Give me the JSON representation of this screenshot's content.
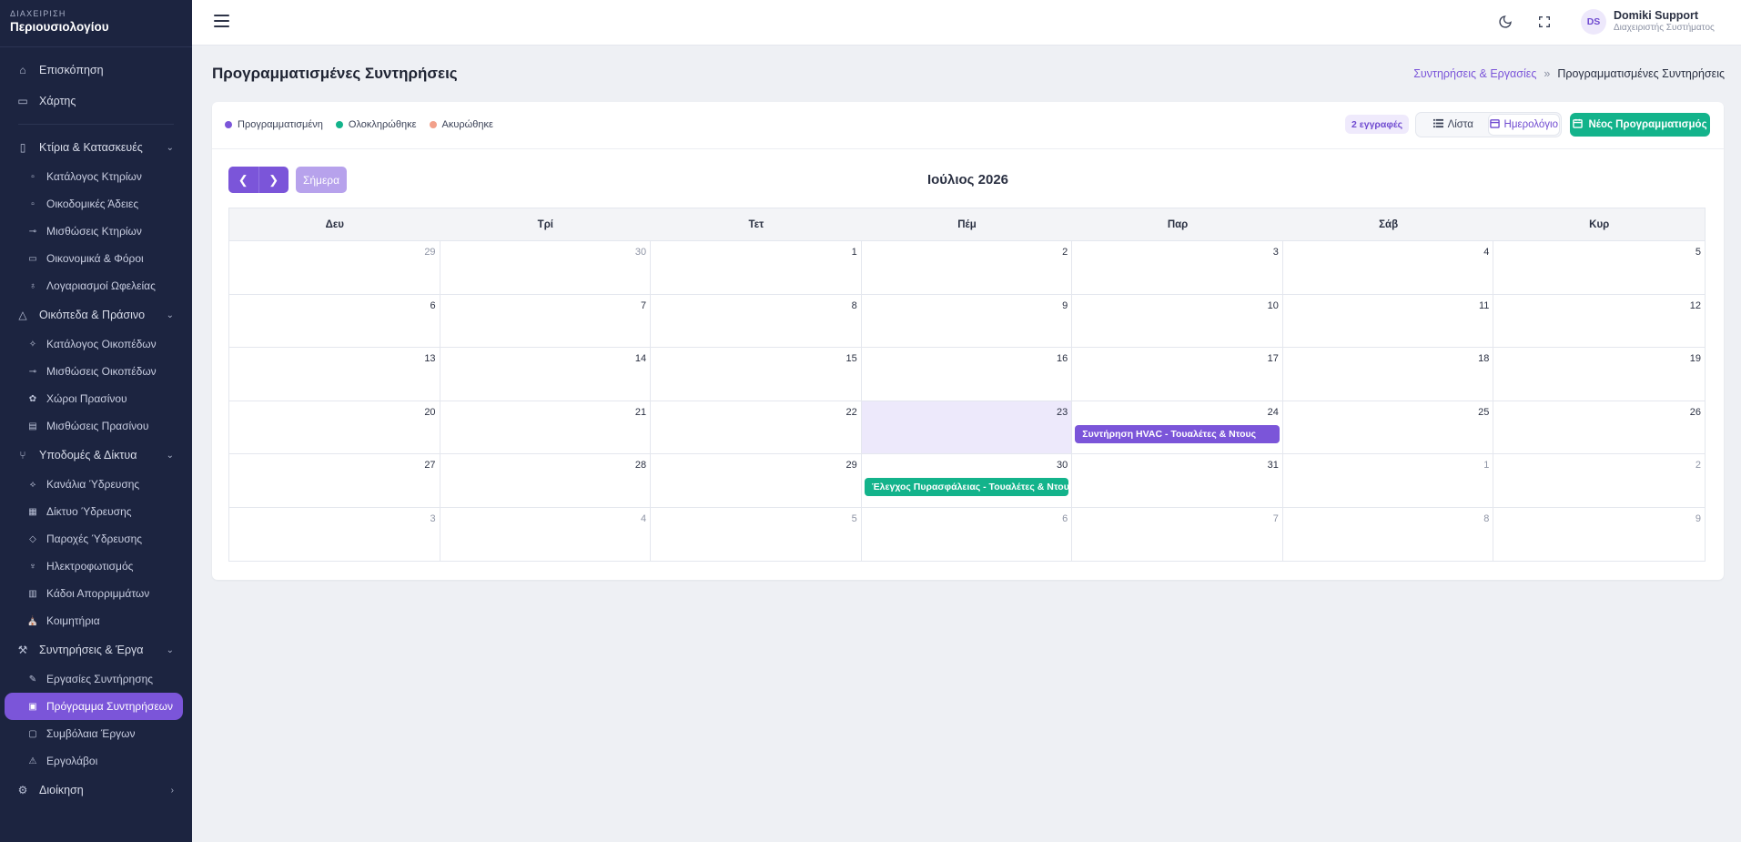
{
  "brand": {
    "small": "ΔΙΑΧΕΙΡΙΣΗ",
    "main": "Περιουσιολογίου"
  },
  "sidebar": {
    "items": [
      {
        "label": "Επισκόπηση",
        "icon": "home-icon"
      },
      {
        "label": "Χάρτης",
        "icon": "map-icon"
      }
    ],
    "groups": [
      {
        "label": "Κτίρια & Κατασκευές",
        "icon": "building-icon",
        "children": [
          "Κατάλογος Κτηρίων",
          "Οικοδομικές Άδειες",
          "Μισθώσεις Κτηρίων",
          "Οικονομικά & Φόροι",
          "Λογαριασμοί Ωφελείας"
        ]
      },
      {
        "label": "Οικόπεδα & Πράσινο",
        "icon": "land-icon",
        "children": [
          "Κατάλογος Οικοπέδων",
          "Μισθώσεις Οικοπέδων",
          "Χώροι Πρασίνου",
          "Μισθώσεις Πρασίνου"
        ]
      },
      {
        "label": "Υποδομές & Δίκτυα",
        "icon": "network-icon",
        "children": [
          "Κανάλια Ύδρευσης",
          "Δίκτυο Ύδρευσης",
          "Παροχές Ύδρευσης",
          "Ηλεκτροφωτισμός",
          "Κάδοι Απορριμμάτων",
          "Κοιμητήρια"
        ]
      },
      {
        "label": "Συντηρήσεις & Έργα",
        "icon": "wrench-icon",
        "children": [
          "Εργασίες Συντήρησης",
          "Πρόγραμμα Συντηρήσεων",
          "Συμβόλαια Έργων",
          "Εργολάβοι"
        ]
      }
    ],
    "admin": "Διοίκηση",
    "active": "Πρόγραμμα Συντηρήσεων"
  },
  "user": {
    "initials": "DS",
    "name": "Domiki Support",
    "role": "Διαχειριστής Συστήματος"
  },
  "page": {
    "title": "Προγραμματισμένες Συντηρήσεις"
  },
  "breadcrumb": {
    "parent": "Συντηρήσεις & Εργασίες",
    "sep": "»",
    "current": "Προγραμματισμένες Συντηρήσεις"
  },
  "legend": [
    {
      "label": "Προγραμματισμένη",
      "color": "#7b55d9"
    },
    {
      "label": "Ολοκληρώθηκε",
      "color": "#13b38b"
    },
    {
      "label": "Ακυρώθηκε",
      "color": "#f2a08a"
    }
  ],
  "toolbar": {
    "count": "2 εγγραφές",
    "list_label": "Λίστα",
    "calendar_label": "Ημερολόγιο",
    "new_label": "Νέος Προγραμματισμός",
    "today_label": "Σήμερα"
  },
  "calendar": {
    "month": "Ιούλιος 2026",
    "weekdays": [
      "Δευ",
      "Τρί",
      "Τετ",
      "Πέμ",
      "Παρ",
      "Σάβ",
      "Κυρ"
    ],
    "days": [
      29,
      30,
      1,
      2,
      3,
      4,
      5,
      6,
      7,
      8,
      9,
      10,
      11,
      12,
      13,
      14,
      15,
      16,
      17,
      18,
      19,
      20,
      21,
      22,
      23,
      24,
      25,
      26,
      27,
      28,
      29,
      30,
      31,
      1,
      2,
      3,
      4,
      5,
      6,
      7,
      8,
      9
    ],
    "other_month_indices": [
      0,
      1,
      33,
      34,
      35,
      36,
      37,
      38,
      39,
      40,
      41
    ],
    "today_index": 24,
    "events": [
      {
        "cell_index": 25,
        "title": "Συντήρηση HVAC - Τουαλέτες & Ντους",
        "color": "#7b55d9"
      },
      {
        "cell_index": 31,
        "title": "Έλεγχος Πυρασφάλειας - Τουαλέτες & Ντουζ",
        "color": "#13b38b"
      }
    ]
  },
  "colors": {
    "accent": "#7b55d9",
    "success": "#13b38b",
    "sidebar_bg": "#1c2440"
  }
}
